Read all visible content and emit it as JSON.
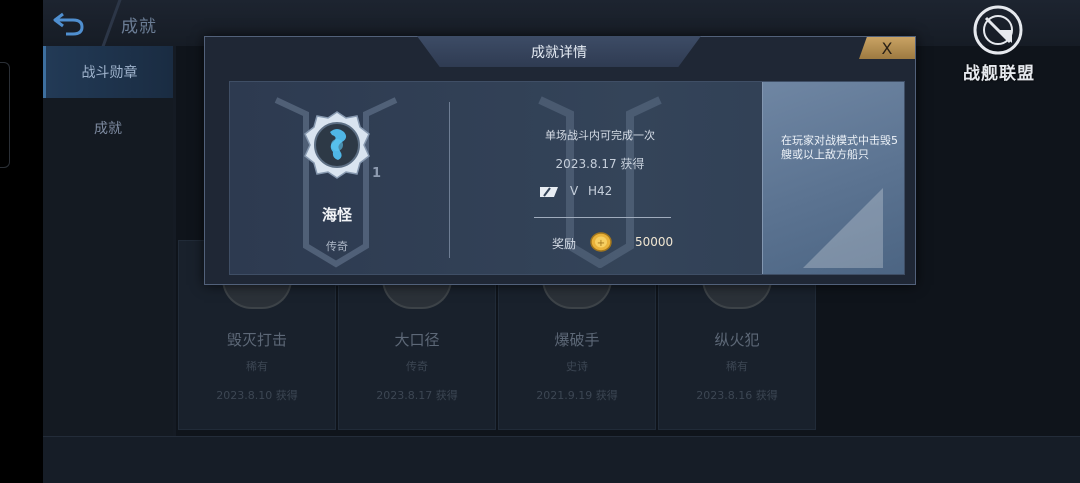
{
  "header": {
    "title": "成就"
  },
  "sidebar": {
    "items": [
      {
        "label": "战斗勋章",
        "active": true
      },
      {
        "label": "成就",
        "active": false
      }
    ]
  },
  "logo": {
    "text": "战舰联盟"
  },
  "background_cards": [
    {
      "name": "毁灭打击",
      "rarity": "稀有",
      "date": "2023.8.10 获得"
    },
    {
      "name": "大口径",
      "rarity": "传奇",
      "date": "2023.8.17 获得"
    },
    {
      "name": "爆破手",
      "rarity": "史诗",
      "date": "2021.9.19 获得"
    },
    {
      "name": "纵火犯",
      "rarity": "稀有",
      "date": "2023.8.16 获得"
    }
  ],
  "modal": {
    "title": "成就详情",
    "close_label": "X",
    "achievement": {
      "name": "海怪",
      "rarity": "传奇",
      "level": "1",
      "description": "单场战斗内可完成一次",
      "date": "2023.8.17 获得",
      "ship_tier": "V",
      "ship_name": "H42",
      "reward_label": "奖励",
      "reward_value": "50000",
      "requirement": "在玩家对战模式中击毁5艘或以上敌方船只"
    }
  },
  "colors": {
    "background": "#151b24",
    "modal": "#1f2735",
    "panel": "#344459",
    "requirement_panel": "#5b7391",
    "close_button": "#c9a364"
  },
  "icons": [
    "back-arrow-icon",
    "badge-icon",
    "ship-class-icon",
    "gold-coin-icon",
    "crosshair-logo-icon"
  ]
}
